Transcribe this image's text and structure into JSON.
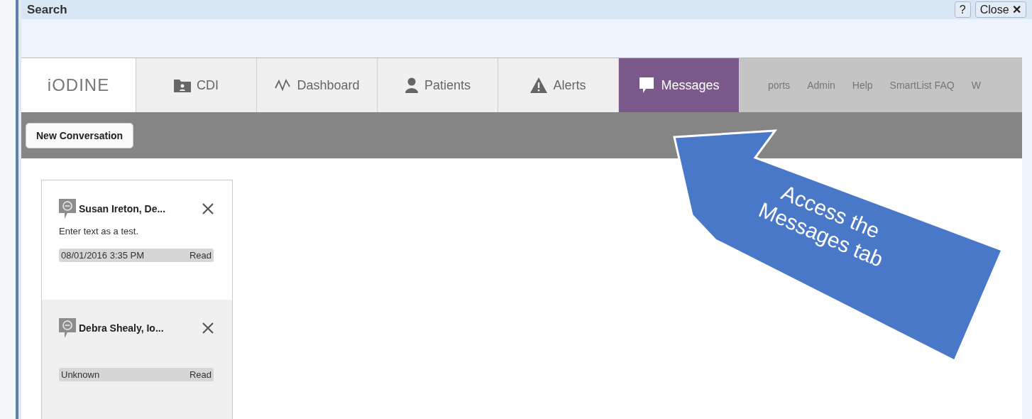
{
  "window": {
    "title": "Search",
    "help_button": "?",
    "close_button": "Close",
    "close_glyph": "✕"
  },
  "nav": {
    "logo": "iODINE",
    "tabs": [
      {
        "label": "CDI",
        "kind": "folder",
        "selected": false
      },
      {
        "label": "Dashboard",
        "kind": "graph",
        "selected": false
      },
      {
        "label": "Patients",
        "kind": "person",
        "selected": false
      },
      {
        "label": "Alerts",
        "kind": "warning",
        "selected": false
      },
      {
        "label": "Messages",
        "kind": "speech",
        "selected": true
      }
    ],
    "links": [
      "ports",
      "Admin",
      "Help",
      "SmartList FAQ",
      "W"
    ]
  },
  "toolbar": {
    "button": "New Conversation"
  },
  "conversations": [
    {
      "name": "Susan Ireton, De...",
      "preview": "Enter text as a test.",
      "time": "08/01/2016 3:35 PM",
      "status": "Read",
      "selected": true
    },
    {
      "name": "Debra Shealy, Io...",
      "time": "Unknown",
      "status": "Read",
      "selected": false
    }
  ],
  "callout": {
    "lines": [
      "Access the",
      "Messages tab"
    ]
  }
}
